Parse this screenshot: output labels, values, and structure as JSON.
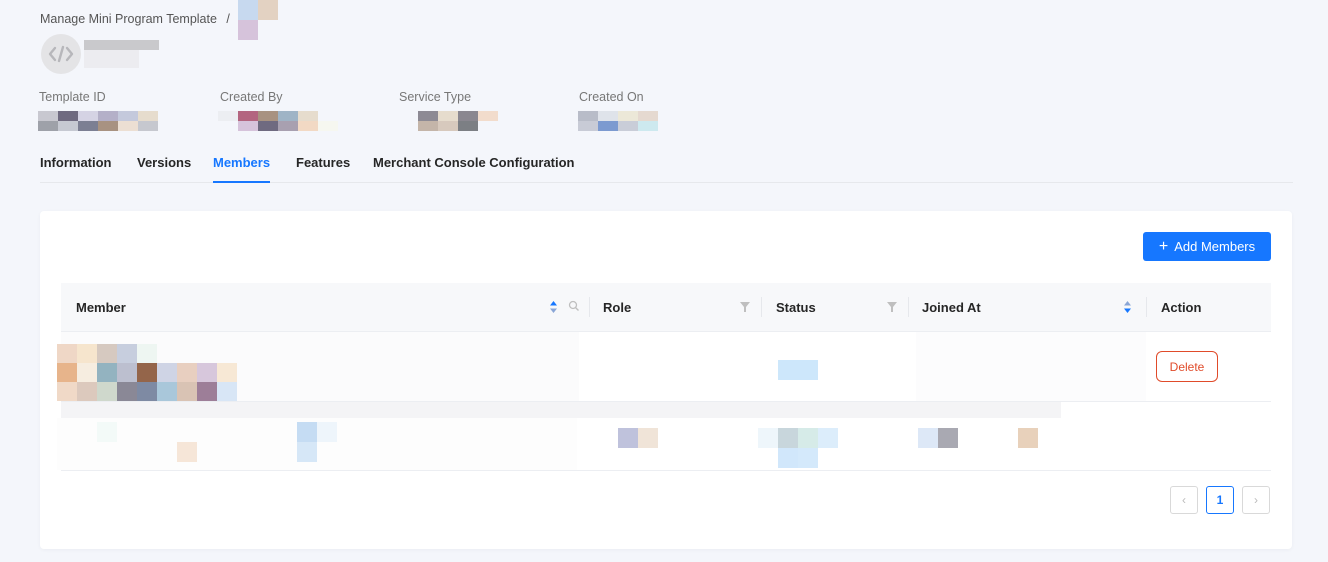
{
  "breadcrumb": {
    "parent": "Manage Mini Program Template",
    "separator": "/"
  },
  "meta": {
    "template_id_label": "Template ID",
    "created_by_label": "Created By",
    "service_type_label": "Service Type",
    "created_on_label": "Created On"
  },
  "tabs": [
    {
      "label": "Information"
    },
    {
      "label": "Versions"
    },
    {
      "label": "Members",
      "active": true
    },
    {
      "label": "Features"
    },
    {
      "label": "Merchant Console Configuration"
    }
  ],
  "toolbar": {
    "add_members_label": "Add Members"
  },
  "table": {
    "columns": [
      "Member",
      "Role",
      "Status",
      "Joined At",
      "Action"
    ],
    "row_action_label": "Delete"
  },
  "pagination": {
    "current_page": "1"
  },
  "colors": {
    "accent": "#1677ff",
    "danger": "#e04b2a"
  }
}
